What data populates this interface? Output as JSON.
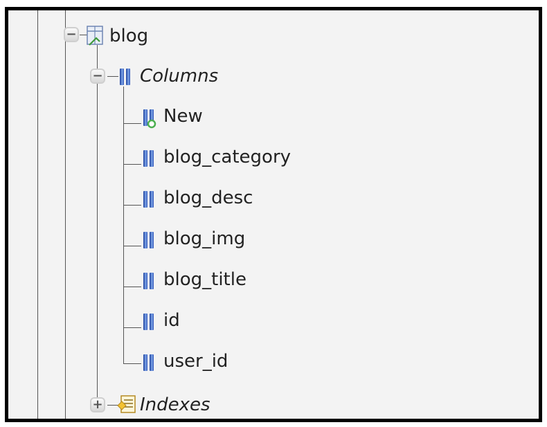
{
  "tree": {
    "table": {
      "label": "blog",
      "expander": "−",
      "icon": "table-icon"
    },
    "columns_folder": {
      "label": "Columns",
      "expander": "−",
      "icon": "columns-icon"
    },
    "columns": [
      {
        "label": "New",
        "icon": "new-column-icon"
      },
      {
        "label": "blog_category",
        "icon": "column-icon"
      },
      {
        "label": "blog_desc",
        "icon": "column-icon"
      },
      {
        "label": "blog_img",
        "icon": "column-icon"
      },
      {
        "label": "blog_title",
        "icon": "column-icon"
      },
      {
        "label": "id",
        "icon": "column-icon"
      },
      {
        "label": "user_id",
        "icon": "column-icon"
      }
    ],
    "indexes_folder": {
      "label": "Indexes",
      "expander": "+",
      "icon": "indexes-icon"
    }
  },
  "colors": {
    "column_icon": "#2b4fb1",
    "new_marker": "#4caf50",
    "tree_line": "#555555"
  }
}
